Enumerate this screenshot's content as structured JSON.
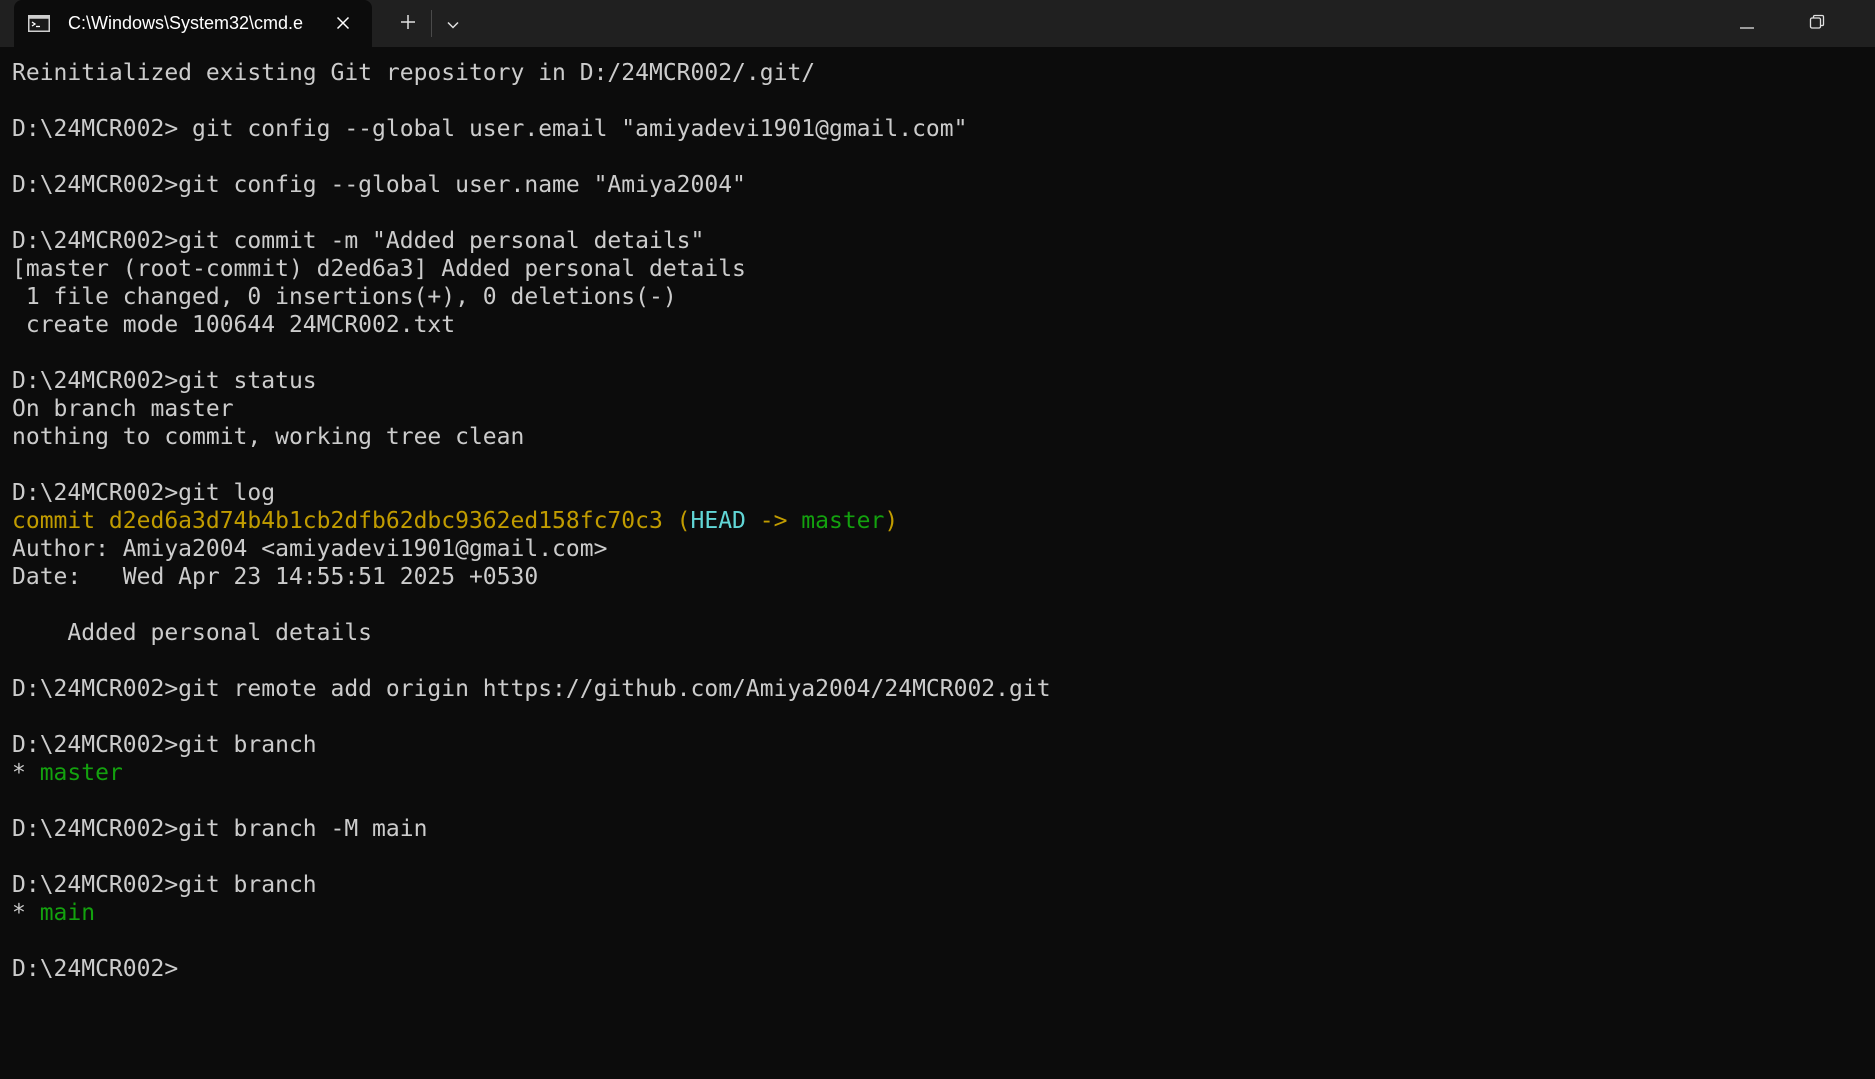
{
  "titlebar": {
    "tab_title": "C:\\Windows\\System32\\cmd.e",
    "icons": {
      "tab": "terminal-icon",
      "close": "close-icon",
      "new_tab": "plus-icon",
      "dropdown": "chevron-down-icon",
      "minimize": "minimize-icon",
      "restore": "restore-icon"
    }
  },
  "colors": {
    "background": "#0c0c0c",
    "text": "#cccccc",
    "yellow": "#c19c00",
    "cyan": "#61d6d6",
    "green": "#13a10e",
    "titlebar": "#202020"
  },
  "terminal": {
    "lines": [
      "Reinitialized existing Git repository in D:/24MCR002/.git/",
      "",
      "D:\\24MCR002> git config --global user.email \"amiyadevi1901@gmail.com\"",
      "",
      "D:\\24MCR002>git config --global user.name \"Amiya2004\"",
      "",
      "D:\\24MCR002>git commit -m \"Added personal details\"",
      "[master (root-commit) d2ed6a3] Added personal details",
      " 1 file changed, 0 insertions(+), 0 deletions(-)",
      " create mode 100644 24MCR002.txt",
      "",
      "D:\\24MCR002>git status",
      "On branch master",
      "nothing to commit, working tree clean",
      "",
      "D:\\24MCR002>git log",
      {
        "segments": [
          {
            "text": "commit d2ed6a3d74b4b1cb2dfb62dbc9362ed158fc70c3 (",
            "color": "yellow"
          },
          {
            "text": "HEAD",
            "color": "cyan"
          },
          {
            "text": " -> ",
            "color": "yellow"
          },
          {
            "text": "master",
            "color": "green"
          },
          {
            "text": ")",
            "color": "yellow"
          }
        ]
      },
      "Author: Amiya2004 <amiyadevi1901@gmail.com>",
      "Date:   Wed Apr 23 14:55:51 2025 +0530",
      "",
      "    Added personal details",
      "",
      "D:\\24MCR002>git remote add origin https://github.com/Amiya2004/24MCR002.git",
      "",
      "D:\\24MCR002>git branch",
      {
        "segments": [
          {
            "text": "* ",
            "color": "default"
          },
          {
            "text": "master",
            "color": "green"
          }
        ]
      },
      "",
      "D:\\24MCR002>git branch -M main",
      "",
      "D:\\24MCR002>git branch",
      {
        "segments": [
          {
            "text": "* ",
            "color": "default"
          },
          {
            "text": "main",
            "color": "green"
          }
        ]
      },
      "",
      "D:\\24MCR002>"
    ]
  }
}
